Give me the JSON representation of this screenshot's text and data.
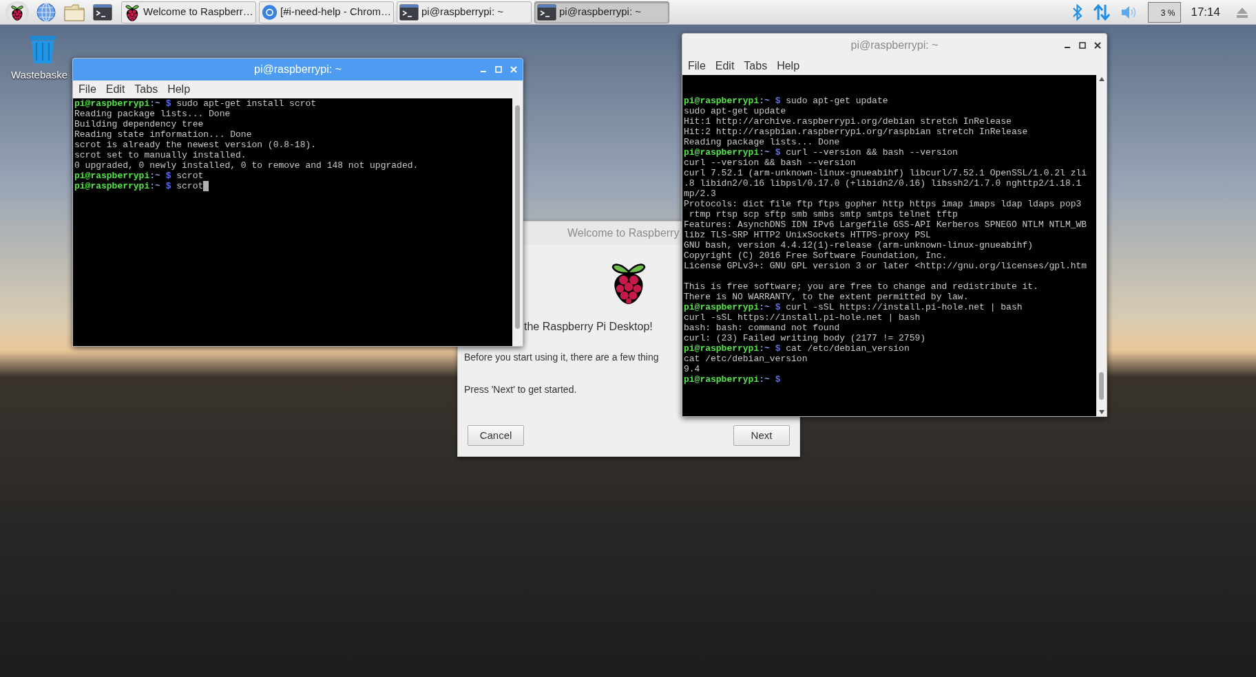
{
  "taskbar": {
    "window_buttons": [
      {
        "kind": "welcome",
        "label": "Welcome to Raspberr…",
        "selected": false
      },
      {
        "kind": "browser",
        "label": "[#i-need-help - Chrom…",
        "selected": false
      },
      {
        "kind": "terminal",
        "label": "pi@raspberrypi: ~",
        "selected": false
      },
      {
        "kind": "terminal",
        "label": "pi@raspberrypi: ~",
        "selected": true
      }
    ],
    "cpu_reading": "3 %",
    "clock": "17:14"
  },
  "desktop_icons": [
    {
      "label": "Wastebaske"
    }
  ],
  "welcome_dialog": {
    "title": "Welcome to Raspberry",
    "heading": "the Raspberry Pi Desktop!",
    "paragraphs": [
      "Before you start using it, there are a few thing",
      "Press 'Next' to get started."
    ],
    "buttons": [
      "Cancel",
      "Next"
    ]
  },
  "terminals": [
    {
      "title": "pi@raspberrypi: ~",
      "active": true,
      "menu": [
        "File",
        "Edit",
        "Tabs",
        "Help"
      ],
      "lines": [
        {
          "kind": "prompt",
          "user": "pi@raspberrypi",
          "path": ":~",
          "symbol": "$",
          "command": "sudo apt-get install scrot",
          "cursor": false
        },
        {
          "kind": "output",
          "text": "Reading package lists... Done"
        },
        {
          "kind": "output",
          "text": "Building dependency tree"
        },
        {
          "kind": "output",
          "text": "Reading state information... Done"
        },
        {
          "kind": "output",
          "text": "scrot is already the newest version (0.8-18)."
        },
        {
          "kind": "output",
          "text": "scrot set to manually installed."
        },
        {
          "kind": "output",
          "text": "0 upgraded, 0 newly installed, 0 to remove and 148 not upgraded."
        },
        {
          "kind": "prompt",
          "user": "pi@raspberrypi",
          "path": ":~",
          "symbol": "$",
          "command": "scrot",
          "cursor": false
        },
        {
          "kind": "prompt",
          "user": "pi@raspberrypi",
          "path": ":~",
          "symbol": "$",
          "command": "scrot",
          "cursor": true
        }
      ]
    },
    {
      "title": "pi@raspberrypi: ~",
      "active": false,
      "menu": [
        "File",
        "Edit",
        "Tabs",
        "Help"
      ],
      "lines": [
        {
          "kind": "blank"
        },
        {
          "kind": "blank"
        },
        {
          "kind": "prompt",
          "user": "pi@raspberrypi",
          "path": ":~",
          "symbol": "$",
          "command": "sudo apt-get update",
          "cursor": false
        },
        {
          "kind": "output",
          "text": "sudo apt-get update"
        },
        {
          "kind": "output",
          "text": "Hit:1 http://archive.raspberrypi.org/debian stretch InRelease"
        },
        {
          "kind": "output",
          "text": "Hit:2 http://raspbian.raspberrypi.org/raspbian stretch InRelease"
        },
        {
          "kind": "output",
          "text": "Reading package lists... Done"
        },
        {
          "kind": "prompt",
          "user": "pi@raspberrypi",
          "path": ":~",
          "symbol": "$",
          "command": "curl --version && bash --version",
          "cursor": false
        },
        {
          "kind": "output",
          "text": "curl --version && bash --version"
        },
        {
          "kind": "output",
          "text": "curl 7.52.1 (arm-unknown-linux-gnueabihf) libcurl/7.52.1 OpenSSL/1.0.2l zli"
        },
        {
          "kind": "output",
          "text": ".8 libidn2/0.16 libpsl/0.17.0 (+libidn2/0.16) libssh2/1.7.0 nghttp2/1.18.1"
        },
        {
          "kind": "output",
          "text": "mp/2.3"
        },
        {
          "kind": "output",
          "text": "Protocols: dict file ftp ftps gopher http https imap imaps ldap ldaps pop3"
        },
        {
          "kind": "output",
          "text": " rtmp rtsp scp sftp smb smbs smtp smtps telnet tftp"
        },
        {
          "kind": "output",
          "text": "Features: AsynchDNS IDN IPv6 Largefile GSS-API Kerberos SPNEGO NTLM NTLM_WB"
        },
        {
          "kind": "output",
          "text": "libz TLS-SRP HTTP2 UnixSockets HTTPS-proxy PSL"
        },
        {
          "kind": "output",
          "text": "GNU bash, version 4.4.12(1)-release (arm-unknown-linux-gnueabihf)"
        },
        {
          "kind": "output",
          "text": "Copyright (C) 2016 Free Software Foundation, Inc."
        },
        {
          "kind": "output",
          "text": "License GPLv3+: GNU GPL version 3 or later <http://gnu.org/licenses/gpl.htm"
        },
        {
          "kind": "blank"
        },
        {
          "kind": "output",
          "text": "This is free software; you are free to change and redistribute it."
        },
        {
          "kind": "output",
          "text": "There is NO WARRANTY, to the extent permitted by law."
        },
        {
          "kind": "prompt",
          "user": "pi@raspberrypi",
          "path": ":~",
          "symbol": "$",
          "command": "curl -sSL https://install.pi-hole.net | bash",
          "cursor": false
        },
        {
          "kind": "output",
          "text": "curl -sSL https://install.pi-hole.net | bash"
        },
        {
          "kind": "output",
          "text": "bash: bash: command not found"
        },
        {
          "kind": "output",
          "text": "curl: (23) Failed writing body (2177 != 2759)"
        },
        {
          "kind": "prompt",
          "user": "pi@raspberrypi",
          "path": ":~",
          "symbol": "$",
          "command": "cat /etc/debian_version",
          "cursor": false
        },
        {
          "kind": "output",
          "text": "cat /etc/debian_version"
        },
        {
          "kind": "output",
          "text": "9.4"
        },
        {
          "kind": "prompt",
          "user": "pi@raspberrypi",
          "path": ":~",
          "symbol": "$",
          "cursor": false
        }
      ]
    }
  ]
}
